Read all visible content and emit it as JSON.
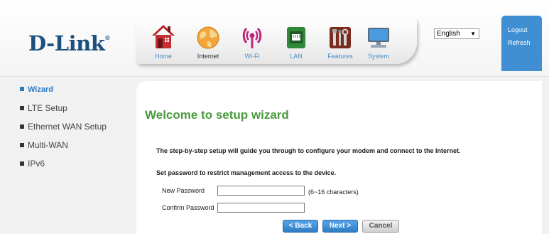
{
  "logo": {
    "text": "D-Link",
    "mark": "®"
  },
  "nav": {
    "items": [
      {
        "label": "Home",
        "icon": "home-icon"
      },
      {
        "label": "Internet",
        "icon": "globe-icon"
      },
      {
        "label": "Wi-Fi",
        "icon": "wifi-icon"
      },
      {
        "label": "LAN",
        "icon": "lan-port-icon"
      },
      {
        "label": "Features",
        "icon": "tools-icon"
      },
      {
        "label": "System",
        "icon": "computer-icon"
      }
    ],
    "active": "Internet"
  },
  "language": {
    "selected": "English"
  },
  "account": {
    "logout_label": "Logout",
    "refresh_label": "Refresh"
  },
  "sidebar": {
    "items": [
      {
        "label": "Wizard",
        "active": true
      },
      {
        "label": "LTE Setup"
      },
      {
        "label": "Ethernet WAN Setup"
      },
      {
        "label": "Multi-WAN"
      },
      {
        "label": "IPv6"
      }
    ]
  },
  "main": {
    "title": "Welcome to setup wizard",
    "description": "The step-by-step setup will guide you through to configure your modem and connect to the Internet.",
    "password_prompt": "Set password to restrict management access to the device.",
    "new_password_label": "New Password",
    "new_password_value": "",
    "new_password_hint": "(6~16 characters)",
    "confirm_password_label": "Confirm Password",
    "confirm_password_value": ""
  },
  "buttons": {
    "back": "< Back",
    "next": "Next >",
    "cancel": "Cancel"
  },
  "colors": {
    "brand": "#1b4f7e",
    "accent": "#3f8fd2",
    "title_green": "#4a9a3e"
  }
}
